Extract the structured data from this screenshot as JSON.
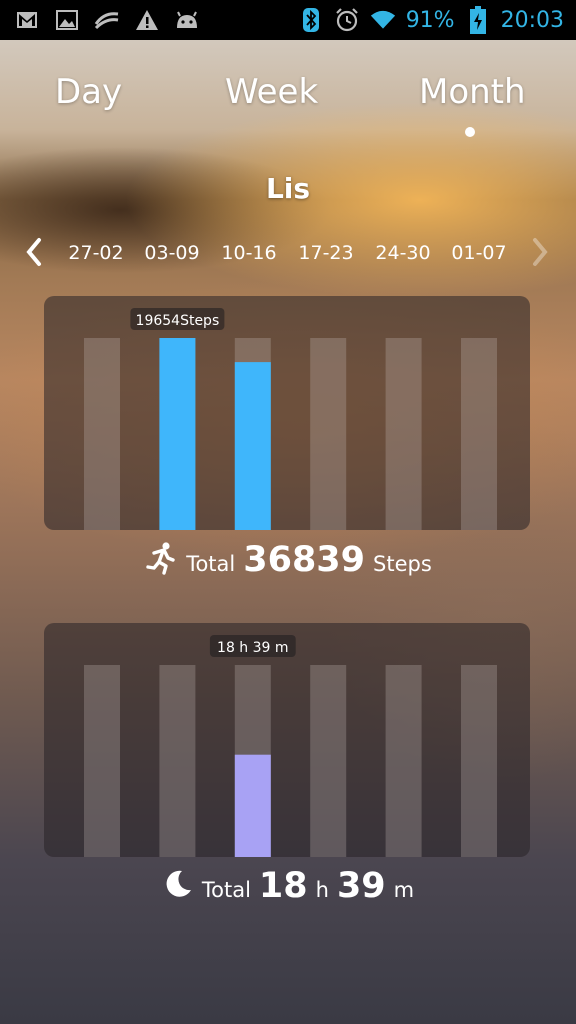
{
  "status_bar": {
    "left_icons": [
      "gmail-icon",
      "gallery-icon",
      "swiftkey-icon",
      "warning-icon",
      "android-icon"
    ],
    "right_icons": [
      "bluetooth-icon",
      "alarm-icon",
      "wifi-icon",
      "battery-charging-icon"
    ],
    "battery_percent": "91%",
    "time": "20:03",
    "accent_color": "#33b5e5"
  },
  "tabs": [
    {
      "label": "Day"
    },
    {
      "label": "Week"
    },
    {
      "label": "Month"
    }
  ],
  "selected_tab": "Month",
  "user_name": "Lis",
  "weeks": [
    "27-02",
    "03-09",
    "10-16",
    "17-23",
    "24-30",
    "01-07"
  ],
  "steps_chart": {
    "highlight_label": "19654Steps",
    "bar_color": "#3fb6fb",
    "empty_color": "rgba(200,190,185,0.28)",
    "max": 19654
  },
  "steps_total": {
    "prefix": "Total",
    "value": "36839",
    "unit": "Steps"
  },
  "sleep_chart": {
    "highlight_label": "18 h 39 m",
    "bar_color": "#a8a2f4",
    "empty_color": "rgba(200,190,185,0.28)"
  },
  "sleep_total": {
    "prefix": "Total",
    "hours": "18",
    "h_label": "h",
    "minutes": "39",
    "m_label": "m"
  },
  "chart_data": [
    {
      "type": "bar",
      "categories": [
        "27-02",
        "03-09",
        "10-16",
        "17-23",
        "24-30",
        "01-07"
      ],
      "series": [
        {
          "values": [
            0,
            19654,
            17185,
            0,
            0,
            0
          ]
        }
      ],
      "ylim": [
        0,
        19654
      ]
    },
    {
      "type": "bar",
      "categories": [
        "27-02",
        "03-09",
        "10-16",
        "17-23",
        "24-30",
        "01-07"
      ],
      "series": [
        {
          "values": [
            0,
            0,
            18.65,
            0,
            0,
            0
          ]
        }
      ],
      "ylim": [
        0,
        35
      ]
    }
  ]
}
